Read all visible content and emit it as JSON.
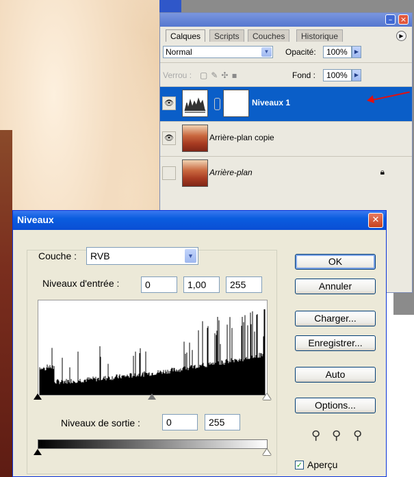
{
  "layers_panel": {
    "tabs": [
      "Calques",
      "Scripts",
      "Couches",
      "Historique"
    ],
    "blend_mode": "Normal",
    "opacity_label": "Opacité:",
    "opacity_value": "100%",
    "lock_label": "Verrou :",
    "fill_label": "Fond :",
    "fill_value": "100%",
    "layers": [
      {
        "name": "Niveaux 1",
        "selected": true,
        "visible": true
      },
      {
        "name": "Arrière-plan copie",
        "selected": false,
        "visible": true
      },
      {
        "name": "Arrière-plan",
        "selected": false,
        "visible": false,
        "locked": true
      }
    ]
  },
  "dialog": {
    "title": "Niveaux",
    "channel_label": "Couche :",
    "channel_value": "RVB",
    "input_levels_label": "Niveaux d'entrée :",
    "input_levels": [
      "0",
      "1,00",
      "255"
    ],
    "output_levels_label": "Niveaux de sortie :",
    "output_levels": [
      "0",
      "255"
    ],
    "buttons": {
      "ok": "OK",
      "cancel": "Annuler",
      "load": "Charger...",
      "save": "Enregistrer...",
      "auto": "Auto",
      "options": "Options..."
    },
    "preview_label": "Aperçu",
    "preview_checked": true
  },
  "colors": {
    "selection": "#0a5ec8",
    "titlebar": "#0a5ddf",
    "annotation_arrow": "#e01010"
  }
}
